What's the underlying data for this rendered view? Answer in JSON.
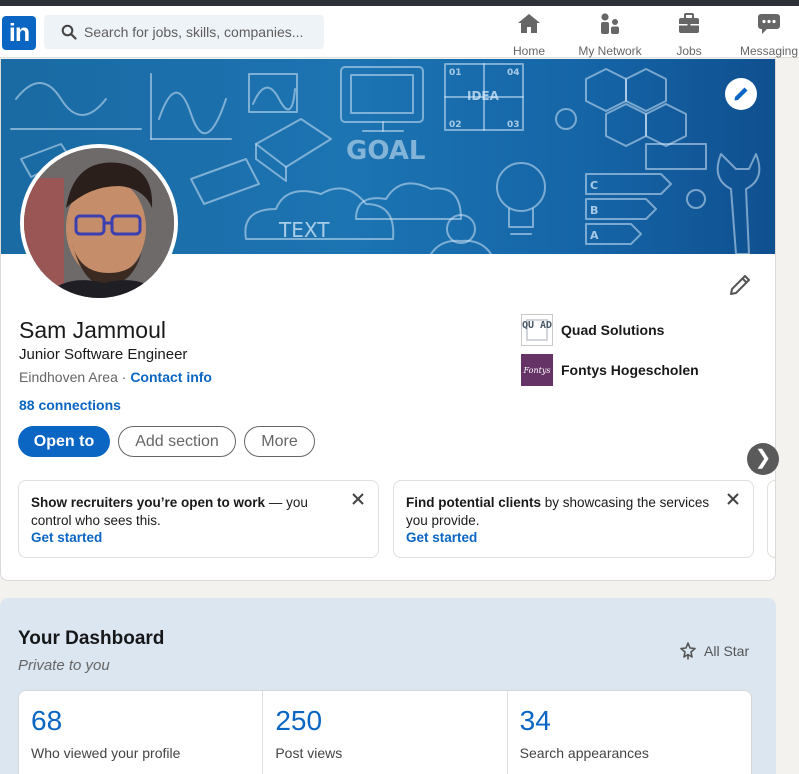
{
  "nav": {
    "logo_text": "in",
    "search_placeholder": "Search for jobs, skills, companies...",
    "items": [
      {
        "label": "Home",
        "icon": "home-icon"
      },
      {
        "label": "My Network",
        "icon": "network-icon"
      },
      {
        "label": "Jobs",
        "icon": "briefcase-icon"
      },
      {
        "label": "Messaging",
        "icon": "chat-icon"
      }
    ]
  },
  "banner": {
    "words": [
      "IDEA",
      "GOAL",
      "TEXT"
    ],
    "diagram_labels": [
      "01",
      "04",
      "02",
      "03",
      "C",
      "B",
      "A"
    ],
    "brand_color": "#0a66c2"
  },
  "profile": {
    "name": "Sam Jammoul",
    "headline": "Junior Software Engineer",
    "location": "Eindhoven Area",
    "separator": "·",
    "contact_info": "Contact info",
    "connections": "88 connections",
    "orgs": [
      {
        "name": "Quad Solutions",
        "logo_text": "QU AD"
      },
      {
        "name": "Fontys Hogescholen",
        "logo_text": "Fontys"
      }
    ],
    "buttons": {
      "open_to": "Open to",
      "add_section": "Add section",
      "more": "More"
    }
  },
  "promos": [
    {
      "bold": "Show recruiters you’re open to work",
      "rest": " — you control who sees this.",
      "cta": "Get started"
    },
    {
      "bold": "Find potential clients",
      "rest": " by showcasing the services you provide.",
      "cta": "Get started"
    }
  ],
  "carousel_next": "❯",
  "dashboard": {
    "title": "Your Dashboard",
    "subtitle": "Private to you",
    "badge": "All Star",
    "stats": [
      {
        "value": "68",
        "label": "Who viewed your profile"
      },
      {
        "value": "250",
        "label": "Post views"
      },
      {
        "value": "34",
        "label": "Search appearances"
      }
    ]
  }
}
